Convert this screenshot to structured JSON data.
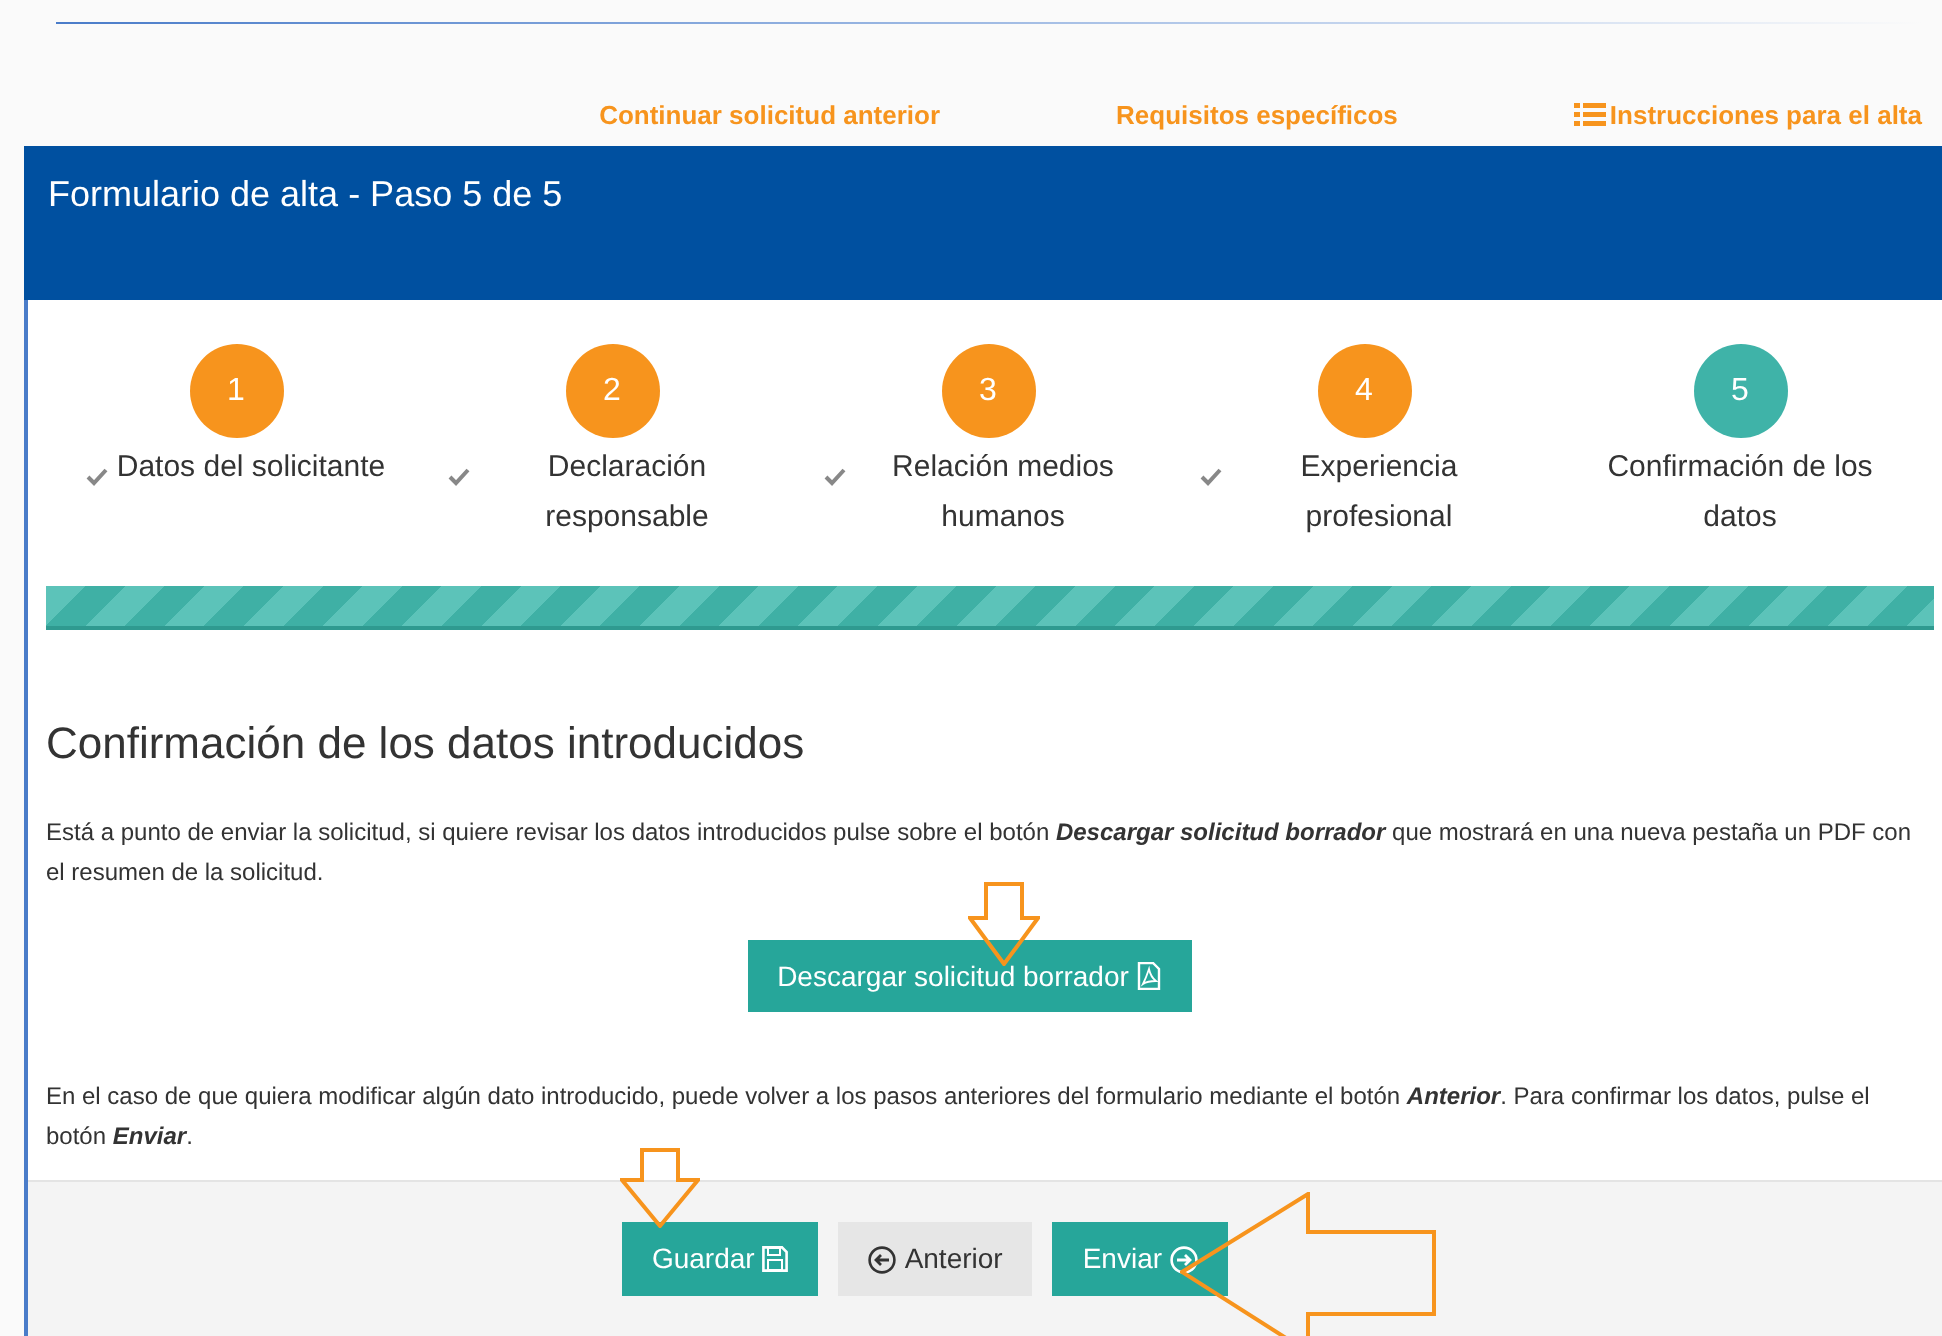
{
  "top_links": [
    {
      "label": "Continuar solicitud anterior",
      "kind": "plain"
    },
    {
      "label": "Requisitos específicos",
      "kind": "plain"
    },
    {
      "label": "Instrucciones para el alta",
      "kind": "list"
    }
  ],
  "header": {
    "title": "Formulario de alta - Paso 5 de 5"
  },
  "steps": [
    {
      "number": "1",
      "label": "Datos del solicitante",
      "completed": true
    },
    {
      "number": "2",
      "label": "Declaración responsable",
      "completed": true
    },
    {
      "number": "3",
      "label": "Relación medios humanos",
      "completed": true
    },
    {
      "number": "4",
      "label": "Experiencia profesional",
      "completed": true
    },
    {
      "number": "5",
      "label": "Confirmación de los datos",
      "completed": false
    }
  ],
  "progress": {
    "level": 1
  },
  "section": {
    "title": "Confirmación de los datos introducidos",
    "intro": "Está a punto de enviar la solicitud, si quiere revisar los datos introducidos pulse sobre el botón **Descargar solicitud borrador** que mostrará en una nueva pestaña un PDF con el resumen de la solicitud.",
    "download_button": "Descargar solicitud borrador",
    "outro": "En el caso de que quiera modificar algún dato introducido, puede volver a los pasos anteriores del formulario mediante el botón **Anterior**. Para confirmar los datos, pulse el botón **Enviar**."
  },
  "buttons": [
    {
      "label": "Guardar",
      "kind": "save"
    },
    {
      "label": "Anterior",
      "kind": "back"
    },
    {
      "label": "Enviar",
      "kind": "send"
    }
  ]
}
